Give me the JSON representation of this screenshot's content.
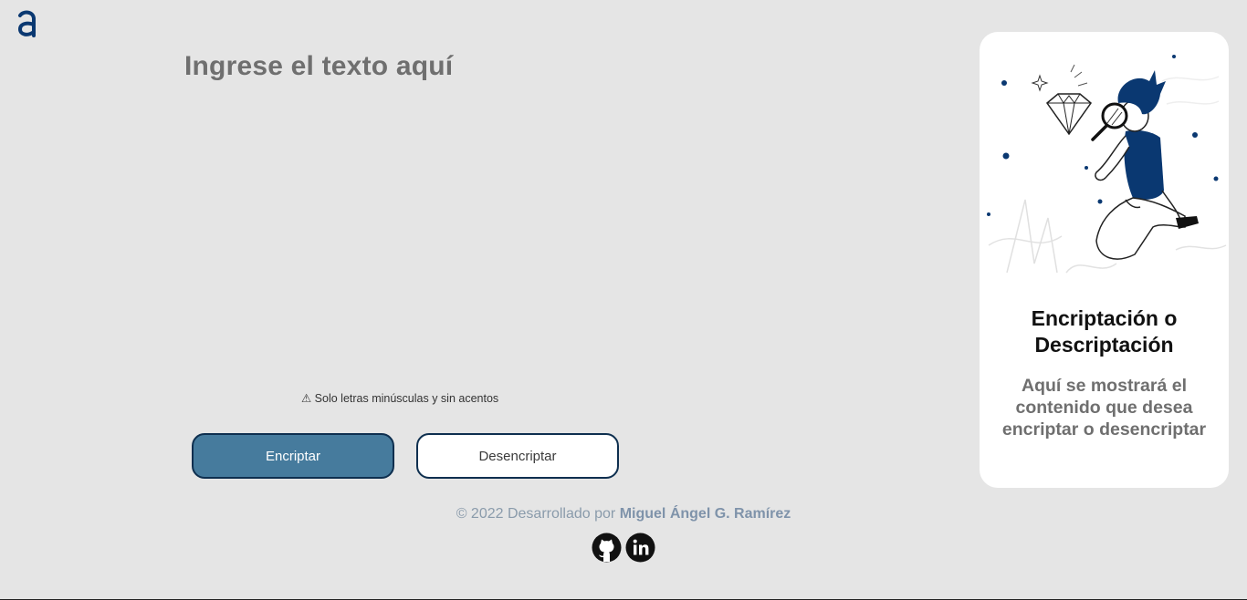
{
  "logo": {
    "icon": "alura-logo-icon",
    "color": "#0a3871"
  },
  "main": {
    "heading": "Ingrese el texto aquí",
    "warning": "⚠ Solo letras minúsculas y sin acentos"
  },
  "buttons": {
    "encrypt_label": "Encriptar",
    "decrypt_label": "Desencriptar",
    "encrypt_color": "#467b9d"
  },
  "output_panel": {
    "illustration": "person-with-magnifying-glass-illustration",
    "title": "Encriptación o Descriptación",
    "text": "Aquí se mostrará el contenido que desea encriptar o desencriptar"
  },
  "footer": {
    "prefix": "© 2022 Desarrollado por",
    "author": "Miguel Ángel G. Ramírez",
    "links": [
      {
        "icon": "github-icon"
      },
      {
        "icon": "linkedin-icon"
      }
    ]
  }
}
